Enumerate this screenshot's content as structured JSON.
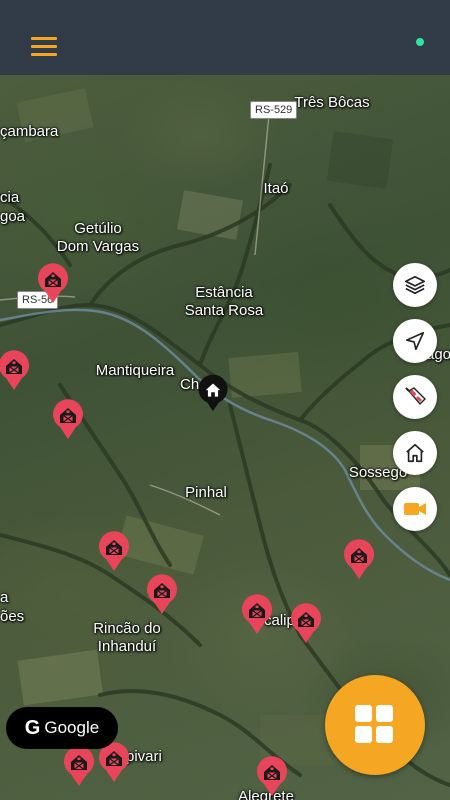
{
  "header": {
    "menu_icon": "hamburger-menu-icon",
    "status_color": "#2ee59d",
    "accent_color": "#f5a623"
  },
  "map": {
    "places": {
      "tres_bocas": "Três Bôcas",
      "cacambara": "çambara",
      "itao": "Itaó",
      "cia": "cia",
      "goa": "goa",
      "getulio": "Getúlio",
      "dom_vargas": "Dom Vargas",
      "estancia": "Estância",
      "santa_rosa": "Santa Rosa",
      "mantiqueira": "Mantiqueira",
      "ch": "Ch",
      "ago": "ago",
      "pinhal": "Pinhal",
      "sossego": "Sossego",
      "a": "a",
      "oes": "ões",
      "rincao": "Rincão do",
      "inhandui": "Inhanduí",
      "calip": "calip",
      "pivari": "pivari",
      "alegrete": "Alegrete"
    },
    "roads": {
      "rs529": "RS-529",
      "rs566": "RS-56"
    },
    "home_marker_icon": "home-icon",
    "farm_pin_icon": "barn-icon",
    "pin_color": "#e8455a",
    "google_logo_letter": "G",
    "google_text": "Google"
  },
  "controls": {
    "layers_icon": "layers-icon",
    "locate_icon": "navigation-arrow-icon",
    "wind_icon": "windsock-icon",
    "home_icon": "home-icon",
    "camera_icon": "video-camera-icon",
    "grid_icon": "grid-icon",
    "camera_color": "#f5a623"
  }
}
